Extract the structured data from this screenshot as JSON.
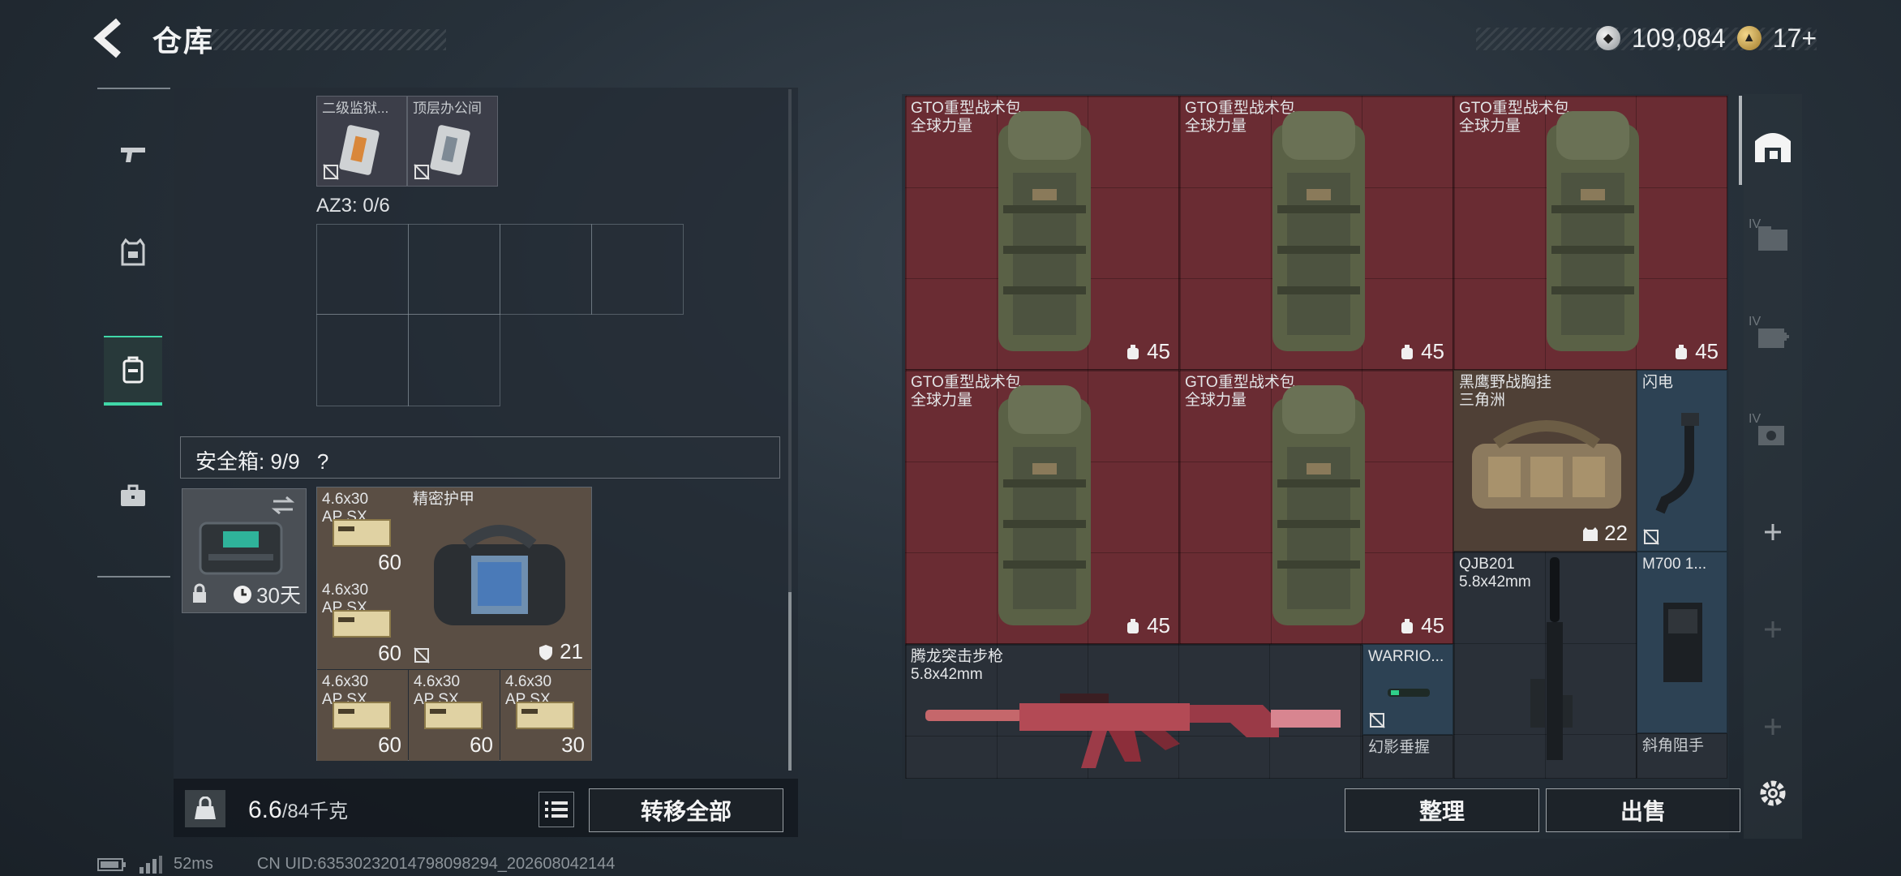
{
  "header": {
    "title": "仓库",
    "currency_1": "109,084",
    "currency_2": "17+"
  },
  "left": {
    "top_items": [
      {
        "label": "二级监狱..."
      },
      {
        "label": "顶层办公间"
      }
    ],
    "az3_label": "AZ3: 0/6",
    "safe_box_label": "安全箱: 9/9",
    "safe_box_help": "?",
    "safe_box_days": "30天",
    "ammo": [
      {
        "caliber": "4.6x30",
        "type": "AP SX",
        "count": "60"
      },
      {
        "caliber": "4.6x30",
        "type": "AP SX",
        "count": "60"
      },
      {
        "caliber": "4.6x30",
        "type": "AP SX",
        "count": "60"
      },
      {
        "caliber": "4.6x30",
        "type": "AP SX",
        "count": "60"
      },
      {
        "caliber": "4.6x30",
        "type": "AP SX",
        "count": "30"
      }
    ],
    "armor_name": "精密护甲",
    "armor_count": "21",
    "weight_current": "6.6",
    "weight_max": "/84千克",
    "transfer_all": "转移全部"
  },
  "right": {
    "backpacks": [
      {
        "name": "GTO重型战术包",
        "sub": "全球力量",
        "count": "45"
      },
      {
        "name": "GTO重型战术包",
        "sub": "全球力量",
        "count": "45"
      },
      {
        "name": "GTO重型战术包",
        "sub": "全球力量",
        "count": "45"
      },
      {
        "name": "GTO重型战术包",
        "sub": "全球力量",
        "count": "45"
      },
      {
        "name": "GTO重型战术包",
        "sub": "全球力量",
        "count": "45"
      }
    ],
    "chest_rig": {
      "name": "黑鹰野战胸挂",
      "sub": "三角洲",
      "count": "22"
    },
    "flash": {
      "name": "闪电"
    },
    "qjb": {
      "name": "QJB201",
      "sub": "5.8x42mm"
    },
    "m700": {
      "name": "M700 1..."
    },
    "rifle": {
      "name": "腾龙突击步枪",
      "sub": "5.8x42mm"
    },
    "warrior": {
      "name": "WARRIO..."
    },
    "grip": {
      "name": "幻影垂握"
    },
    "angled": {
      "name": "斜角阻手"
    },
    "organize": "整理",
    "sell": "出售"
  },
  "tools": [
    "IV",
    "IV",
    "IV"
  ],
  "status": {
    "ping": "52ms",
    "uid": "CN UID:6353023201479809829​4_202608042144"
  }
}
